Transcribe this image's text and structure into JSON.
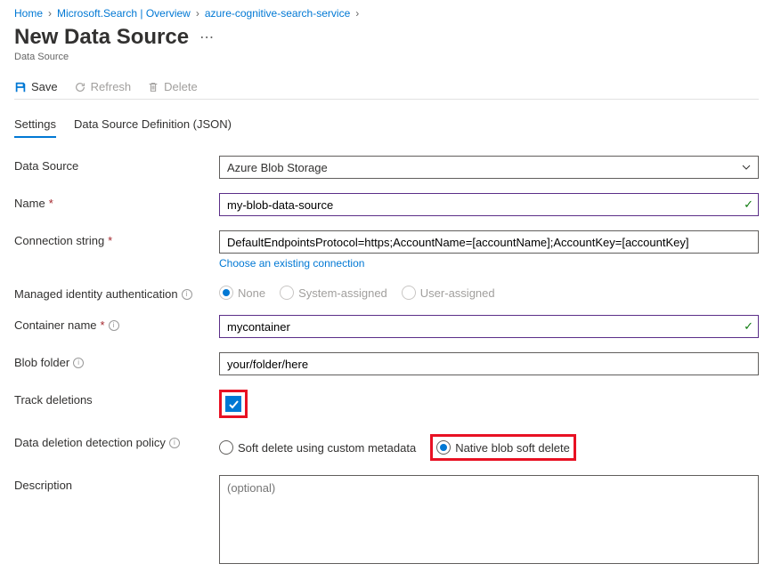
{
  "breadcrumb": {
    "items": [
      "Home",
      "Microsoft.Search | Overview",
      "azure-cognitive-search-service"
    ]
  },
  "page": {
    "title": "New Data Source",
    "subtitle": "Data Source"
  },
  "toolbar": {
    "save": "Save",
    "refresh": "Refresh",
    "delete": "Delete"
  },
  "tabs": {
    "settings": "Settings",
    "json": "Data Source Definition (JSON)"
  },
  "form": {
    "dataSource": {
      "label": "Data Source",
      "value": "Azure Blob Storage"
    },
    "name": {
      "label": "Name",
      "value": "my-blob-data-source"
    },
    "connectionString": {
      "label": "Connection string",
      "value": "DefaultEndpointsProtocol=https;AccountName=[accountName];AccountKey=[accountKey]",
      "link": "Choose an existing connection"
    },
    "managedIdentity": {
      "label": "Managed identity authentication",
      "options": {
        "none": "None",
        "system": "System-assigned",
        "user": "User-assigned"
      }
    },
    "containerName": {
      "label": "Container name",
      "value": "mycontainer"
    },
    "blobFolder": {
      "label": "Blob folder",
      "value": "your/folder/here"
    },
    "trackDeletions": {
      "label": "Track deletions"
    },
    "deletionPolicy": {
      "label": "Data deletion detection policy",
      "options": {
        "soft": "Soft delete using custom metadata",
        "native": "Native blob soft delete"
      }
    },
    "description": {
      "label": "Description",
      "placeholder": "(optional)"
    }
  }
}
